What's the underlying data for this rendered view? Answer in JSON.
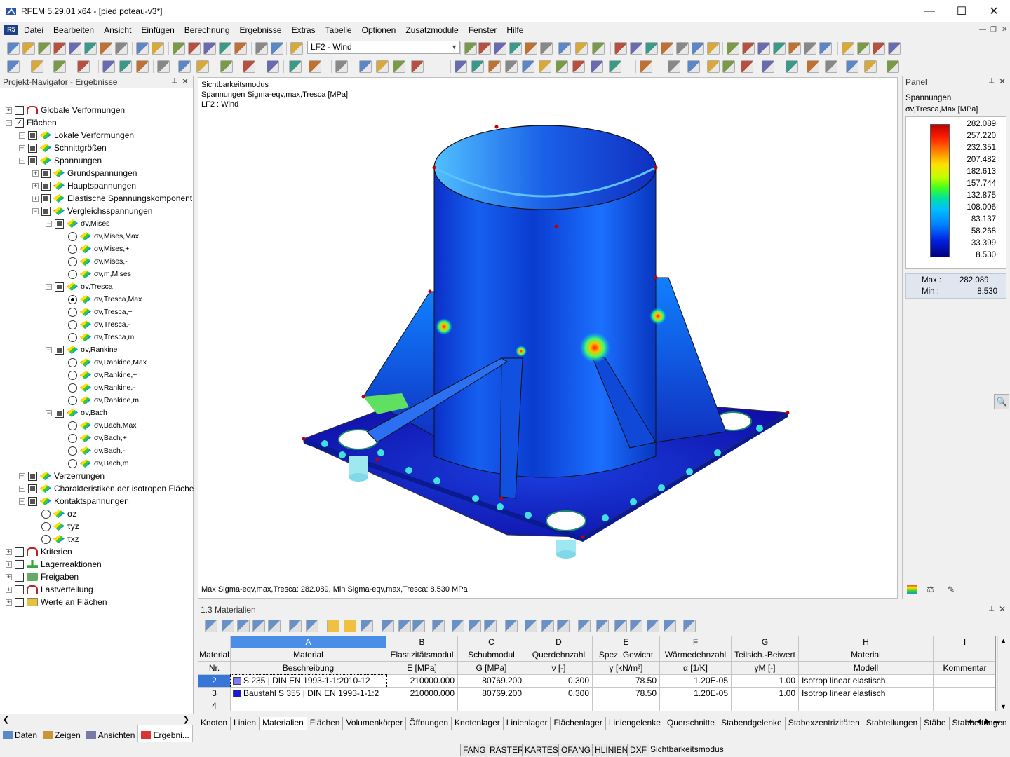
{
  "window": {
    "title": "RFEM 5.29.01 x64 - [pied poteau-v3*]",
    "minimize": "—",
    "maximize": "☐",
    "close": "✕"
  },
  "menu": [
    "Datei",
    "Bearbeiten",
    "Ansicht",
    "Einfügen",
    "Berechnung",
    "Ergebnisse",
    "Extras",
    "Tabelle",
    "Optionen",
    "Zusatzmodule",
    "Fenster",
    "Hilfe"
  ],
  "toolbar": {
    "load_case": "LF2 - Wind"
  },
  "navigator": {
    "title": "Projekt-Navigator - Ergebnisse",
    "items": [
      {
        "label": "Globale Verformungen",
        "level": 0,
        "exp": "+",
        "check": "box",
        "icon": "deform"
      },
      {
        "label": "Flächen",
        "level": 0,
        "exp": "−",
        "check": "full",
        "icon": "none"
      },
      {
        "label": "Lokale Verformungen",
        "level": 1,
        "exp": "+",
        "check": "part",
        "icon": "stress"
      },
      {
        "label": "Schnittgrößen",
        "level": 1,
        "exp": "+",
        "check": "part",
        "icon": "stress"
      },
      {
        "label": "Spannungen",
        "level": 1,
        "exp": "−",
        "check": "part",
        "icon": "stress"
      },
      {
        "label": "Grundspannungen",
        "level": 2,
        "exp": "+",
        "check": "part",
        "icon": "stress"
      },
      {
        "label": "Hauptspannungen",
        "level": 2,
        "exp": "+",
        "check": "part",
        "icon": "stress"
      },
      {
        "label": "Elastische Spannungskomponent",
        "level": 2,
        "exp": "+",
        "check": "part",
        "icon": "stress"
      },
      {
        "label": "Vergleichsspannungen",
        "level": 2,
        "exp": "−",
        "check": "part",
        "icon": "stress"
      },
      {
        "label": "σv,Mises",
        "level": 3,
        "exp": "−",
        "check": "part",
        "icon": "stress"
      },
      {
        "label": "σv,Mises,Max",
        "level": 4,
        "exp": "",
        "check": "radio",
        "icon": "stress"
      },
      {
        "label": "σv,Mises,+",
        "level": 4,
        "exp": "",
        "check": "radio",
        "icon": "stress"
      },
      {
        "label": "σv,Mises,-",
        "level": 4,
        "exp": "",
        "check": "radio",
        "icon": "stress"
      },
      {
        "label": "σv,m,Mises",
        "level": 4,
        "exp": "",
        "check": "radio",
        "icon": "stress"
      },
      {
        "label": "σv,Tresca",
        "level": 3,
        "exp": "−",
        "check": "part",
        "icon": "stress"
      },
      {
        "label": "σv,Tresca,Max",
        "level": 4,
        "exp": "",
        "check": "radio-on",
        "icon": "stress"
      },
      {
        "label": "σv,Tresca,+",
        "level": 4,
        "exp": "",
        "check": "radio",
        "icon": "stress"
      },
      {
        "label": "σv,Tresca,-",
        "level": 4,
        "exp": "",
        "check": "radio",
        "icon": "stress"
      },
      {
        "label": "σv,Tresca,m",
        "level": 4,
        "exp": "",
        "check": "radio",
        "icon": "stress"
      },
      {
        "label": "σv,Rankine",
        "level": 3,
        "exp": "−",
        "check": "part",
        "icon": "stress"
      },
      {
        "label": "σv,Rankine,Max",
        "level": 4,
        "exp": "",
        "check": "radio",
        "icon": "stress"
      },
      {
        "label": "σv,Rankine,+",
        "level": 4,
        "exp": "",
        "check": "radio",
        "icon": "stress"
      },
      {
        "label": "σv,Rankine,-",
        "level": 4,
        "exp": "",
        "check": "radio",
        "icon": "stress"
      },
      {
        "label": "σv,Rankine,m",
        "level": 4,
        "exp": "",
        "check": "radio",
        "icon": "stress"
      },
      {
        "label": "σv,Bach",
        "level": 3,
        "exp": "−",
        "check": "part",
        "icon": "stress"
      },
      {
        "label": "σv,Bach,Max",
        "level": 4,
        "exp": "",
        "check": "radio",
        "icon": "stress"
      },
      {
        "label": "σv,Bach,+",
        "level": 4,
        "exp": "",
        "check": "radio",
        "icon": "stress"
      },
      {
        "label": "σv,Bach,-",
        "level": 4,
        "exp": "",
        "check": "radio",
        "icon": "stress"
      },
      {
        "label": "σv,Bach,m",
        "level": 4,
        "exp": "",
        "check": "radio",
        "icon": "stress"
      },
      {
        "label": "Verzerrungen",
        "level": 1,
        "exp": "+",
        "check": "part",
        "icon": "stress"
      },
      {
        "label": "Charakteristiken der isotropen Fläche",
        "level": 1,
        "exp": "+",
        "check": "part",
        "icon": "stress"
      },
      {
        "label": "Kontaktspannungen",
        "level": 1,
        "exp": "−",
        "check": "part",
        "icon": "stress"
      },
      {
        "label": "σz",
        "level": 2,
        "exp": "",
        "check": "radio",
        "icon": "stress"
      },
      {
        "label": "τyz",
        "level": 2,
        "exp": "",
        "check": "radio",
        "icon": "stress"
      },
      {
        "label": "τxz",
        "level": 2,
        "exp": "",
        "check": "radio",
        "icon": "stress"
      },
      {
        "label": "Kriterien",
        "level": 0,
        "exp": "+",
        "check": "box",
        "icon": "deform"
      },
      {
        "label": "Lagerreaktionen",
        "level": 0,
        "exp": "+",
        "check": "box",
        "icon": "react"
      },
      {
        "label": "Freigaben",
        "level": 0,
        "exp": "+",
        "check": "box",
        "icon": "gen"
      },
      {
        "label": "Lastverteilung",
        "level": 0,
        "exp": "+",
        "check": "box",
        "icon": "deform"
      },
      {
        "label": "Werte an Flächen",
        "level": 0,
        "exp": "+",
        "check": "box",
        "icon": "yel"
      }
    ],
    "tabs": [
      "Daten",
      "Zeigen",
      "Ansichten",
      "Ergebni..."
    ]
  },
  "viewport": {
    "line1": "Sichtbarkeitsmodus",
    "line2": "Spannungen Sigma-eqv,max,Tresca [MPa]",
    "line3": "LF2 : Wind",
    "footer": "Max Sigma-eqv,max,Tresca: 282.089, Min Sigma-eqv,max,Tresca: 8.530 MPa"
  },
  "panel": {
    "title": "Panel",
    "heading": "Spannungen",
    "quantity": "σv,Tresca,Max [MPa]",
    "legend_values": [
      "282.089",
      "257.220",
      "232.351",
      "207.482",
      "182.613",
      "157.744",
      "132.875",
      "108.006",
      "83.137",
      "58.268",
      "33.399",
      "8.530"
    ],
    "max_label": "Max :",
    "max_value": "282.089",
    "min_label": "Min :",
    "min_value": "8.530",
    "colors": {
      "max": "#c00000",
      "min": "#000080"
    }
  },
  "table": {
    "title": "1.3 Materialien",
    "col_letters": [
      "A",
      "B",
      "C",
      "D",
      "E",
      "F",
      "G",
      "H",
      "I"
    ],
    "header_row1": [
      "Material",
      "Material",
      "Elastizitätsmodul",
      "Schubmodul",
      "Querdehnzahl",
      "Spez. Gewicht",
      "Wärmedehnzahl",
      "Teilsich.-Beiwert",
      "Material",
      ""
    ],
    "header_row2": [
      "Nr.",
      "Beschreibung",
      "E [MPa]",
      "G [MPa]",
      "ν [-]",
      "γ [kN/m³]",
      "α [1/K]",
      "γM [-]",
      "Modell",
      "Kommentar"
    ],
    "rows": [
      {
        "nr": "2",
        "desc": "S 235 | DIN EN 1993-1-1:2010-12",
        "e": "210000.000",
        "g": "80769.200",
        "nu": "0.300",
        "gamma": "78.50",
        "alpha": "1.20E-05",
        "gm": "1.00",
        "model": "Isotrop linear elastisch",
        "comment": "",
        "swatch": "#7c7cf0"
      },
      {
        "nr": "3",
        "desc": "Baustahl S 355 | DIN EN 1993-1-1:2",
        "e": "210000.000",
        "g": "80769.200",
        "nu": "0.300",
        "gamma": "78.50",
        "alpha": "1.20E-05",
        "gm": "1.00",
        "model": "Isotrop linear elastisch",
        "comment": "",
        "swatch": "#1a1ad0"
      },
      {
        "nr": "4",
        "desc": "",
        "e": "",
        "g": "",
        "nu": "",
        "gamma": "",
        "alpha": "",
        "gm": "",
        "model": "",
        "comment": "",
        "swatch": ""
      }
    ],
    "tabs": [
      "Knoten",
      "Linien",
      "Materialien",
      "Flächen",
      "Volumenkörper",
      "Öffnungen",
      "Knotenlager",
      "Linienlager",
      "Flächenlager",
      "Liniengelenke",
      "Querschnitte",
      "Stabendgelenke",
      "Stabexzentrizitäten",
      "Stabteilungen",
      "Stäbe",
      "Stabbettungen"
    ]
  },
  "status": [
    "FANG",
    "RASTER",
    "KARTES",
    "OFANG",
    "HLINIEN",
    "DXF",
    "Sichtbarkeitsmodus"
  ]
}
